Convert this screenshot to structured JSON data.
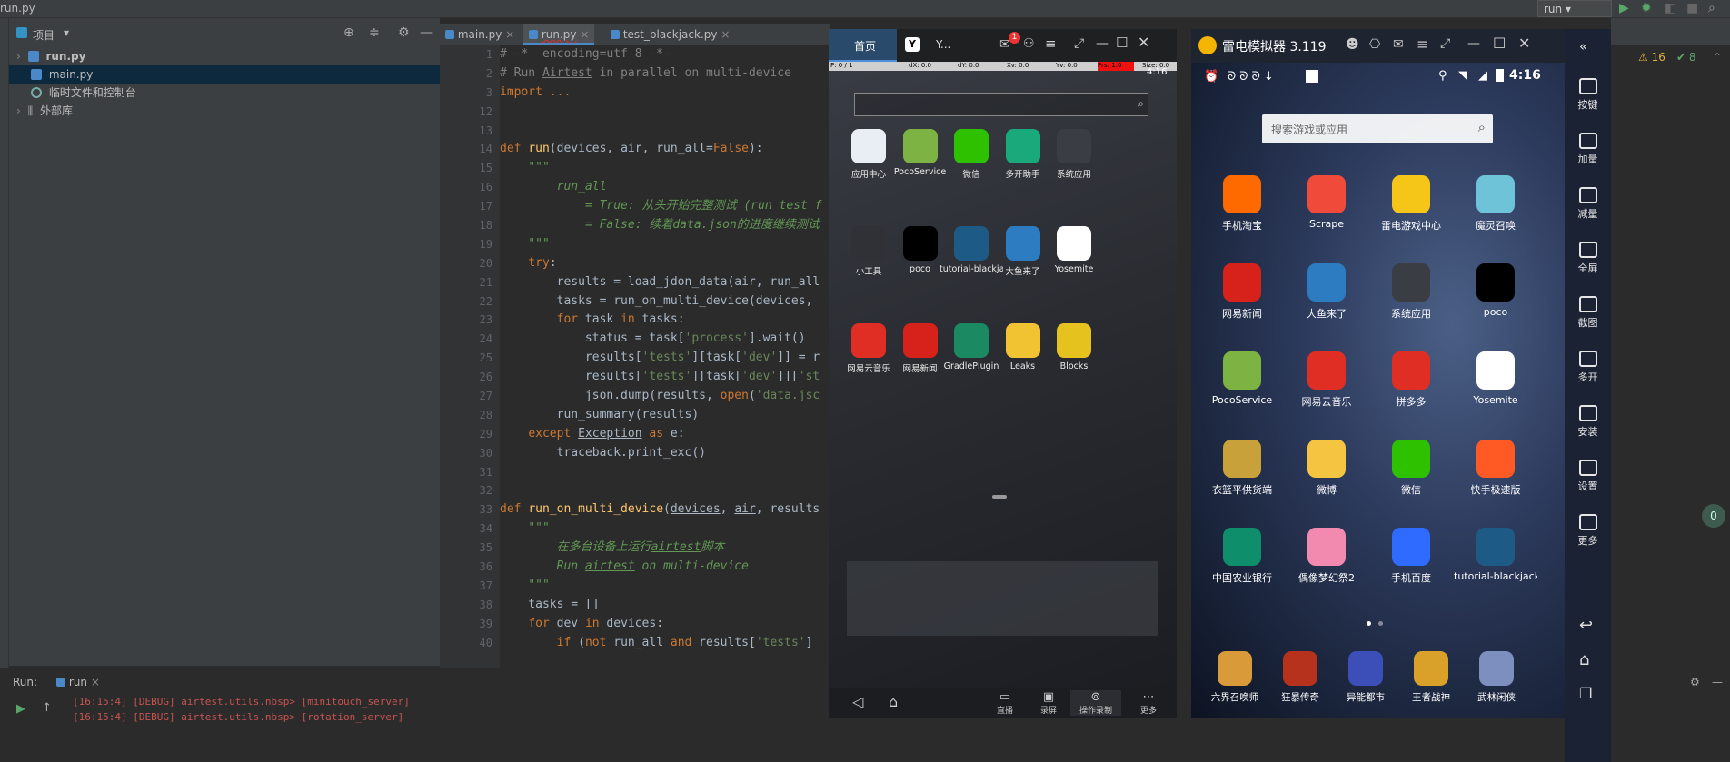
{
  "ide": {
    "window_title": "run.py",
    "run_config": "run",
    "project_header": "项目",
    "tree": [
      {
        "label": "run.py"
      },
      {
        "label": "main.py"
      },
      {
        "label": "临时文件和控制台"
      },
      {
        "label": "外部库"
      }
    ],
    "tabs": [
      {
        "label": "main.py"
      },
      {
        "label": "run.py"
      },
      {
        "label": "test_blackjack.py"
      }
    ],
    "inspection": {
      "warnings": "16",
      "ok": "8"
    },
    "code_lines": [
      {
        "n": "1",
        "segments": [
          {
            "t": "# -*- encoding=utf-8 -*-",
            "c": "com"
          }
        ]
      },
      {
        "n": "2",
        "segments": [
          {
            "t": "# Run ",
            "c": "com"
          },
          {
            "t": "Airtest",
            "c": "com und"
          },
          {
            "t": " in parallel on multi-device",
            "c": "com"
          }
        ]
      },
      {
        "n": "3",
        "segments": [
          {
            "t": "import ...",
            "c": "kw"
          }
        ]
      },
      {
        "n": "12",
        "segments": []
      },
      {
        "n": "13",
        "segments": []
      },
      {
        "n": "14",
        "segments": [
          {
            "t": "def ",
            "c": "kw"
          },
          {
            "t": "run",
            "c": "fn"
          },
          {
            "t": "(",
            "c": ""
          },
          {
            "t": "devices",
            "c": "und"
          },
          {
            "t": ", ",
            "c": ""
          },
          {
            "t": "air",
            "c": "und"
          },
          {
            "t": ", run_all=",
            "c": ""
          },
          {
            "t": "False",
            "c": "kw"
          },
          {
            "t": "):",
            "c": ""
          }
        ]
      },
      {
        "n": "15",
        "segments": [
          {
            "t": "    \"\"\"",
            "c": "doc"
          }
        ]
      },
      {
        "n": "16",
        "segments": [
          {
            "t": "        run_all",
            "c": "doc"
          }
        ]
      },
      {
        "n": "17",
        "segments": [
          {
            "t": "            = True: 从头开始完整测试 (run test f",
            "c": "doc"
          }
        ]
      },
      {
        "n": "18",
        "segments": [
          {
            "t": "            = False: 续着data.json的进度继续测试",
            "c": "doc"
          }
        ]
      },
      {
        "n": "19",
        "segments": [
          {
            "t": "    \"\"\"",
            "c": "doc"
          }
        ]
      },
      {
        "n": "20",
        "segments": [
          {
            "t": "    ",
            "c": ""
          },
          {
            "t": "try",
            "c": "kw"
          },
          {
            "t": ":",
            "c": ""
          }
        ]
      },
      {
        "n": "21",
        "segments": [
          {
            "t": "        results = load_jdon_data(air, run_all",
            "c": ""
          }
        ]
      },
      {
        "n": "22",
        "segments": [
          {
            "t": "        tasks = run_on_multi_device(devices, ",
            "c": ""
          }
        ]
      },
      {
        "n": "23",
        "segments": [
          {
            "t": "        ",
            "c": ""
          },
          {
            "t": "for",
            "c": "kw"
          },
          {
            "t": " task ",
            "c": ""
          },
          {
            "t": "in",
            "c": "kw"
          },
          {
            "t": " tasks:",
            "c": ""
          }
        ]
      },
      {
        "n": "24",
        "segments": [
          {
            "t": "            status = task[",
            "c": ""
          },
          {
            "t": "'process'",
            "c": "str"
          },
          {
            "t": "].wait()",
            "c": ""
          }
        ]
      },
      {
        "n": "25",
        "segments": [
          {
            "t": "            results[",
            "c": ""
          },
          {
            "t": "'tests'",
            "c": "str"
          },
          {
            "t": "][task[",
            "c": ""
          },
          {
            "t": "'dev'",
            "c": "str"
          },
          {
            "t": "]] = r",
            "c": ""
          }
        ]
      },
      {
        "n": "26",
        "segments": [
          {
            "t": "            results[",
            "c": ""
          },
          {
            "t": "'tests'",
            "c": "str"
          },
          {
            "t": "][task[",
            "c": ""
          },
          {
            "t": "'dev'",
            "c": "str"
          },
          {
            "t": "]][",
            "c": ""
          },
          {
            "t": "'st",
            "c": "str"
          }
        ]
      },
      {
        "n": "27",
        "segments": [
          {
            "t": "            json.dump(results, ",
            "c": ""
          },
          {
            "t": "open",
            "c": "kw"
          },
          {
            "t": "(",
            "c": ""
          },
          {
            "t": "'data.jsc",
            "c": "str"
          }
        ]
      },
      {
        "n": "28",
        "segments": [
          {
            "t": "        run_summary(results)",
            "c": ""
          }
        ]
      },
      {
        "n": "29",
        "segments": [
          {
            "t": "    ",
            "c": ""
          },
          {
            "t": "except",
            "c": "kw"
          },
          {
            "t": " ",
            "c": ""
          },
          {
            "t": "Exception",
            "c": "und"
          },
          {
            "t": " ",
            "c": ""
          },
          {
            "t": "as",
            "c": "kw"
          },
          {
            "t": " e:",
            "c": ""
          }
        ]
      },
      {
        "n": "30",
        "segments": [
          {
            "t": "        traceback.print_exc()",
            "c": ""
          }
        ]
      },
      {
        "n": "31",
        "segments": []
      },
      {
        "n": "32",
        "segments": []
      },
      {
        "n": "33",
        "segments": [
          {
            "t": "def ",
            "c": "kw"
          },
          {
            "t": "run_on_multi_device",
            "c": "fn"
          },
          {
            "t": "(",
            "c": ""
          },
          {
            "t": "devices",
            "c": "und"
          },
          {
            "t": ", ",
            "c": ""
          },
          {
            "t": "air",
            "c": "und"
          },
          {
            "t": ", results",
            "c": ""
          }
        ]
      },
      {
        "n": "34",
        "segments": [
          {
            "t": "    \"\"\"",
            "c": "doc"
          }
        ]
      },
      {
        "n": "35",
        "segments": [
          {
            "t": "        在多台设备上运行",
            "c": "doc"
          },
          {
            "t": "airtest",
            "c": "doc und"
          },
          {
            "t": "脚本",
            "c": "doc"
          }
        ]
      },
      {
        "n": "36",
        "segments": [
          {
            "t": "        Run ",
            "c": "doc"
          },
          {
            "t": "airtest",
            "c": "doc und"
          },
          {
            "t": " on multi-device",
            "c": "doc"
          }
        ]
      },
      {
        "n": "37",
        "segments": [
          {
            "t": "    \"\"\"",
            "c": "doc"
          }
        ]
      },
      {
        "n": "38",
        "segments": [
          {
            "t": "    tasks = []",
            "c": ""
          }
        ]
      },
      {
        "n": "39",
        "segments": [
          {
            "t": "    ",
            "c": ""
          },
          {
            "t": "for",
            "c": "kw"
          },
          {
            "t": " dev ",
            "c": ""
          },
          {
            "t": "in",
            "c": "kw"
          },
          {
            "t": " devices:",
            "c": ""
          }
        ]
      },
      {
        "n": "40",
        "segments": [
          {
            "t": "        ",
            "c": ""
          },
          {
            "t": "if",
            "c": "kw"
          },
          {
            "t": " (",
            "c": ""
          },
          {
            "t": "not",
            "c": "kw"
          },
          {
            "t": " run_all ",
            "c": ""
          },
          {
            "t": "and",
            "c": "kw"
          },
          {
            "t": " results[",
            "c": ""
          },
          {
            "t": "'tests'",
            "c": "str"
          },
          {
            "t": "]",
            "c": ""
          }
        ]
      }
    ],
    "run_panel": {
      "label": "Run:",
      "tab": "run",
      "log_lines": [
        "[16:15:4] [DEBUG] airtest.utils.nbsp> [minitouch_server]",
        "[16:15:4] [DEBUG] airtest.utils.nbsp> [rotation_server]"
      ]
    }
  },
  "emulator1": {
    "tabs": [
      {
        "label": "首页"
      },
      {
        "label": "Y..."
      }
    ],
    "notif_badge": "1",
    "clock": "4:16",
    "status": [
      "P: 0 / 1",
      "dX: 0.0",
      "dY: 0.0",
      "Xv: 0.0",
      "Yv: 0.0",
      "Prs: 1.0",
      "Size: 0.0"
    ],
    "apps": [
      {
        "label": "应用中心",
        "color": "#e9eef5",
        "icon": "store-icon"
      },
      {
        "label": "PocoService",
        "color": "#7cb342",
        "icon": "android-icon"
      },
      {
        "label": "微信",
        "color": "#2dc100",
        "icon": "wechat-icon"
      },
      {
        "label": "多开助手",
        "color": "#1aa97b",
        "icon": "multi-open-icon"
      },
      {
        "label": "系统应用",
        "color": "#3a3d44",
        "icon": "folder-icon"
      },
      {
        "label": "小工具",
        "color": "#2f3137",
        "icon": "folder-icon"
      },
      {
        "label": "poco",
        "color": "#000000",
        "icon": "poco-icon"
      },
      {
        "label": "tutorial-blackja...",
        "color": "#1d5b86",
        "icon": "game-icon"
      },
      {
        "label": "大鱼来了",
        "color": "#2d7cc1",
        "icon": "shark-icon"
      },
      {
        "label": "Yosemite",
        "color": "#ffffff",
        "icon": "yosemite-icon"
      },
      {
        "label": "网易云音乐",
        "color": "#e02e24",
        "icon": "music-icon"
      },
      {
        "label": "网易新闻",
        "color": "#d7221c",
        "icon": "news-icon"
      },
      {
        "label": "GradlePlugin",
        "color": "#1b8a62",
        "icon": "android-icon"
      },
      {
        "label": "Leaks",
        "color": "#f1c232",
        "icon": "leaks-icon"
      },
      {
        "label": "Blocks",
        "color": "#e6c21f",
        "icon": "blocks-icon"
      }
    ],
    "nav": [
      {
        "label": "直播"
      },
      {
        "label": "录屏"
      },
      {
        "label": "操作录制"
      },
      {
        "label": "更多"
      }
    ]
  },
  "emulator2": {
    "title": "雷电模拟器 3.119",
    "clock": "4:16",
    "search_placeholder": "搜索游戏或应用",
    "apps": [
      {
        "label": "手机淘宝",
        "color": "#ff6a00",
        "icon": "taobao-icon"
      },
      {
        "label": "Scrape",
        "color": "#f04b3a",
        "icon": "scrape-icon"
      },
      {
        "label": "雷电游戏中心",
        "color": "#f5c518",
        "icon": "gamepad-icon"
      },
      {
        "label": "魔灵召唤",
        "color": "#6ec3d8",
        "icon": "game-icon"
      },
      {
        "label": "网易新闻",
        "color": "#d7221c",
        "icon": "news-icon"
      },
      {
        "label": "大鱼来了",
        "color": "#2d7cc1",
        "icon": "shark-icon"
      },
      {
        "label": "系统应用",
        "color": "#3a3d44",
        "icon": "folder-icon"
      },
      {
        "label": "poco",
        "color": "#000000",
        "icon": "poco-icon"
      },
      {
        "label": "PocoService",
        "color": "#7cb342",
        "icon": "android-icon"
      },
      {
        "label": "网易云音乐",
        "color": "#e02e24",
        "icon": "music-icon"
      },
      {
        "label": "拼多多",
        "color": "#e02e24",
        "icon": "pinduoduo-icon"
      },
      {
        "label": "Yosemite",
        "color": "#ffffff",
        "icon": "yosemite-icon"
      },
      {
        "label": "衣篮平供货端",
        "color": "#c9a13b",
        "icon": "app-icon"
      },
      {
        "label": "微博",
        "color": "#f5c542",
        "icon": "weibo-icon"
      },
      {
        "label": "微信",
        "color": "#2dc100",
        "icon": "wechat-icon"
      },
      {
        "label": "快手极速版",
        "color": "#ff5a24",
        "icon": "kuaishou-icon"
      },
      {
        "label": "中国农业银行",
        "color": "#0e8e6a",
        "icon": "bank-icon"
      },
      {
        "label": "偶像梦幻祭2",
        "color": "#f28ab0",
        "icon": "game-icon"
      },
      {
        "label": "手机百度",
        "color": "#2f6bff",
        "icon": "baidu-icon"
      },
      {
        "label": "tutorial-blackjack",
        "color": "#1d5b86",
        "icon": "game-icon"
      }
    ],
    "dock": [
      {
        "label": "六界召唤师",
        "color": "#d99a3a"
      },
      {
        "label": "狂暴传奇",
        "color": "#b7321c"
      },
      {
        "label": "异能都市",
        "color": "#3c4fb8"
      },
      {
        "label": "王者战神",
        "color": "#d9a02a"
      },
      {
        "label": "武林闲侠",
        "color": "#7d8fbf"
      }
    ],
    "side": [
      {
        "label": "按键"
      },
      {
        "label": "加量"
      },
      {
        "label": "减量"
      },
      {
        "label": "全屏"
      },
      {
        "label": "截图"
      },
      {
        "label": "多开"
      },
      {
        "label": "安装"
      },
      {
        "label": "设置"
      },
      {
        "label": "更多"
      }
    ]
  }
}
